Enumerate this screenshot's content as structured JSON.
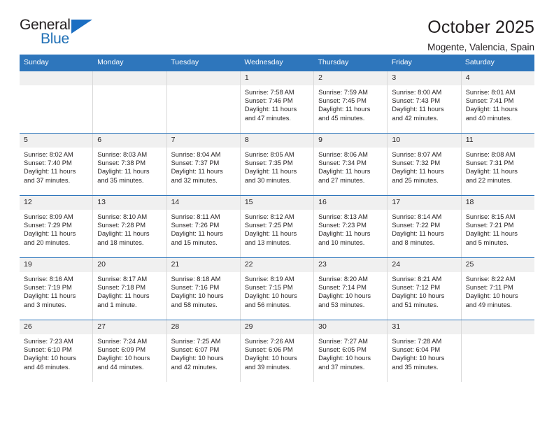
{
  "brand": {
    "word_one": "General",
    "word_two": "Blue",
    "accent_color": "#1b6ec2"
  },
  "header": {
    "title": "October 2025",
    "location": "Mogente, Valencia, Spain"
  },
  "calendar": {
    "header_bg": "#2e76bc",
    "weekdays": [
      "Sunday",
      "Monday",
      "Tuesday",
      "Wednesday",
      "Thursday",
      "Friday",
      "Saturday"
    ],
    "labels": {
      "sunrise": "Sunrise:",
      "sunset": "Sunset:",
      "daylight": "Daylight:"
    },
    "weeks": [
      [
        {
          "day": ""
        },
        {
          "day": ""
        },
        {
          "day": ""
        },
        {
          "day": "1",
          "sunrise": "Sunrise: 7:58 AM",
          "sunset": "Sunset: 7:46 PM",
          "daylight": "Daylight: 11 hours and 47 minutes."
        },
        {
          "day": "2",
          "sunrise": "Sunrise: 7:59 AM",
          "sunset": "Sunset: 7:45 PM",
          "daylight": "Daylight: 11 hours and 45 minutes."
        },
        {
          "day": "3",
          "sunrise": "Sunrise: 8:00 AM",
          "sunset": "Sunset: 7:43 PM",
          "daylight": "Daylight: 11 hours and 42 minutes."
        },
        {
          "day": "4",
          "sunrise": "Sunrise: 8:01 AM",
          "sunset": "Sunset: 7:41 PM",
          "daylight": "Daylight: 11 hours and 40 minutes."
        }
      ],
      [
        {
          "day": "5",
          "sunrise": "Sunrise: 8:02 AM",
          "sunset": "Sunset: 7:40 PM",
          "daylight": "Daylight: 11 hours and 37 minutes."
        },
        {
          "day": "6",
          "sunrise": "Sunrise: 8:03 AM",
          "sunset": "Sunset: 7:38 PM",
          "daylight": "Daylight: 11 hours and 35 minutes."
        },
        {
          "day": "7",
          "sunrise": "Sunrise: 8:04 AM",
          "sunset": "Sunset: 7:37 PM",
          "daylight": "Daylight: 11 hours and 32 minutes."
        },
        {
          "day": "8",
          "sunrise": "Sunrise: 8:05 AM",
          "sunset": "Sunset: 7:35 PM",
          "daylight": "Daylight: 11 hours and 30 minutes."
        },
        {
          "day": "9",
          "sunrise": "Sunrise: 8:06 AM",
          "sunset": "Sunset: 7:34 PM",
          "daylight": "Daylight: 11 hours and 27 minutes."
        },
        {
          "day": "10",
          "sunrise": "Sunrise: 8:07 AM",
          "sunset": "Sunset: 7:32 PM",
          "daylight": "Daylight: 11 hours and 25 minutes."
        },
        {
          "day": "11",
          "sunrise": "Sunrise: 8:08 AM",
          "sunset": "Sunset: 7:31 PM",
          "daylight": "Daylight: 11 hours and 22 minutes."
        }
      ],
      [
        {
          "day": "12",
          "sunrise": "Sunrise: 8:09 AM",
          "sunset": "Sunset: 7:29 PM",
          "daylight": "Daylight: 11 hours and 20 minutes."
        },
        {
          "day": "13",
          "sunrise": "Sunrise: 8:10 AM",
          "sunset": "Sunset: 7:28 PM",
          "daylight": "Daylight: 11 hours and 18 minutes."
        },
        {
          "day": "14",
          "sunrise": "Sunrise: 8:11 AM",
          "sunset": "Sunset: 7:26 PM",
          "daylight": "Daylight: 11 hours and 15 minutes."
        },
        {
          "day": "15",
          "sunrise": "Sunrise: 8:12 AM",
          "sunset": "Sunset: 7:25 PM",
          "daylight": "Daylight: 11 hours and 13 minutes."
        },
        {
          "day": "16",
          "sunrise": "Sunrise: 8:13 AM",
          "sunset": "Sunset: 7:23 PM",
          "daylight": "Daylight: 11 hours and 10 minutes."
        },
        {
          "day": "17",
          "sunrise": "Sunrise: 8:14 AM",
          "sunset": "Sunset: 7:22 PM",
          "daylight": "Daylight: 11 hours and 8 minutes."
        },
        {
          "day": "18",
          "sunrise": "Sunrise: 8:15 AM",
          "sunset": "Sunset: 7:21 PM",
          "daylight": "Daylight: 11 hours and 5 minutes."
        }
      ],
      [
        {
          "day": "19",
          "sunrise": "Sunrise: 8:16 AM",
          "sunset": "Sunset: 7:19 PM",
          "daylight": "Daylight: 11 hours and 3 minutes."
        },
        {
          "day": "20",
          "sunrise": "Sunrise: 8:17 AM",
          "sunset": "Sunset: 7:18 PM",
          "daylight": "Daylight: 11 hours and 1 minute."
        },
        {
          "day": "21",
          "sunrise": "Sunrise: 8:18 AM",
          "sunset": "Sunset: 7:16 PM",
          "daylight": "Daylight: 10 hours and 58 minutes."
        },
        {
          "day": "22",
          "sunrise": "Sunrise: 8:19 AM",
          "sunset": "Sunset: 7:15 PM",
          "daylight": "Daylight: 10 hours and 56 minutes."
        },
        {
          "day": "23",
          "sunrise": "Sunrise: 8:20 AM",
          "sunset": "Sunset: 7:14 PM",
          "daylight": "Daylight: 10 hours and 53 minutes."
        },
        {
          "day": "24",
          "sunrise": "Sunrise: 8:21 AM",
          "sunset": "Sunset: 7:12 PM",
          "daylight": "Daylight: 10 hours and 51 minutes."
        },
        {
          "day": "25",
          "sunrise": "Sunrise: 8:22 AM",
          "sunset": "Sunset: 7:11 PM",
          "daylight": "Daylight: 10 hours and 49 minutes."
        }
      ],
      [
        {
          "day": "26",
          "sunrise": "Sunrise: 7:23 AM",
          "sunset": "Sunset: 6:10 PM",
          "daylight": "Daylight: 10 hours and 46 minutes."
        },
        {
          "day": "27",
          "sunrise": "Sunrise: 7:24 AM",
          "sunset": "Sunset: 6:09 PM",
          "daylight": "Daylight: 10 hours and 44 minutes."
        },
        {
          "day": "28",
          "sunrise": "Sunrise: 7:25 AM",
          "sunset": "Sunset: 6:07 PM",
          "daylight": "Daylight: 10 hours and 42 minutes."
        },
        {
          "day": "29",
          "sunrise": "Sunrise: 7:26 AM",
          "sunset": "Sunset: 6:06 PM",
          "daylight": "Daylight: 10 hours and 39 minutes."
        },
        {
          "day": "30",
          "sunrise": "Sunrise: 7:27 AM",
          "sunset": "Sunset: 6:05 PM",
          "daylight": "Daylight: 10 hours and 37 minutes."
        },
        {
          "day": "31",
          "sunrise": "Sunrise: 7:28 AM",
          "sunset": "Sunset: 6:04 PM",
          "daylight": "Daylight: 10 hours and 35 minutes."
        },
        {
          "day": ""
        }
      ]
    ]
  }
}
